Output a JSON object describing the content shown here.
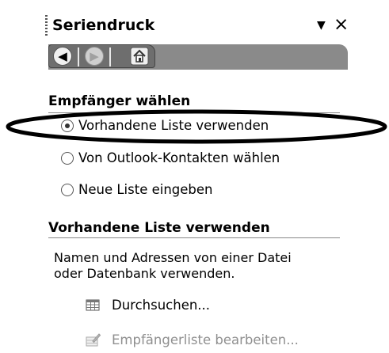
{
  "pane": {
    "title": "Seriendruck",
    "dropdown_icon": "dropdown-arrow-icon",
    "close_icon": "close-icon"
  },
  "toolbar": {
    "back_icon": "back-icon",
    "forward_icon": "forward-icon",
    "home_icon": "home-icon"
  },
  "recipients": {
    "heading": "Empfänger wählen",
    "options": [
      {
        "label": "Vorhandene Liste verwenden",
        "selected": true
      },
      {
        "label": "Von Outlook-Kontakten wählen",
        "selected": false
      },
      {
        "label": "Neue Liste eingeben",
        "selected": false
      }
    ]
  },
  "existing_list": {
    "heading": "Vorhandene Liste verwenden",
    "description": "Namen und Adressen von einer Datei oder Datenbank verwenden.",
    "browse_label": "Durchsuchen...",
    "browse_icon": "table-icon",
    "edit_label": "Empfängerliste bearbeiten...",
    "edit_icon": "edit-list-icon",
    "edit_enabled": false
  },
  "annotation": {
    "shape": "ellipse",
    "color": "#000000"
  }
}
